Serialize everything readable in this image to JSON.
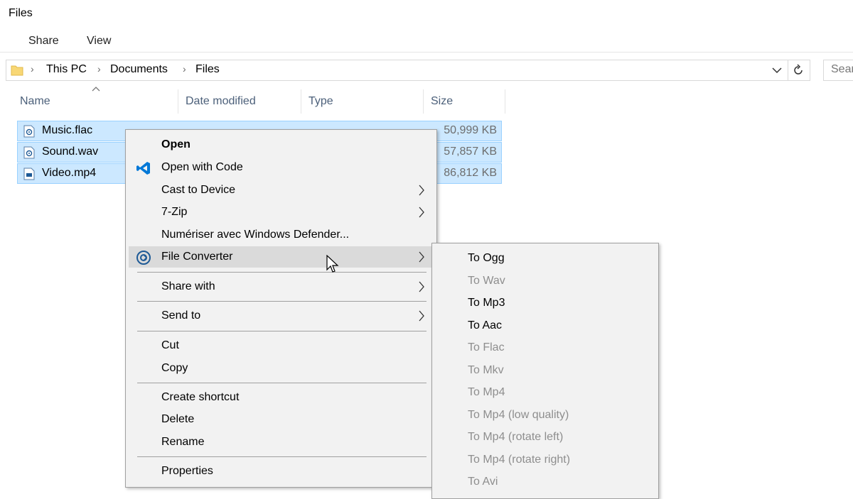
{
  "window": {
    "title": "Files"
  },
  "ribbon": {
    "tabs": [
      "Share",
      "View"
    ]
  },
  "address": {
    "crumbs": [
      "This PC",
      "Documents",
      "Files"
    ],
    "search_placeholder": "Search"
  },
  "columns": {
    "name": "Name",
    "date": "Date modified",
    "type": "Type",
    "size": "Size"
  },
  "files": [
    {
      "name": "Music.flac",
      "date": "",
      "type": "",
      "size": "50,999 KB",
      "icon": "audio-file-icon"
    },
    {
      "name": "Sound.wav",
      "date": "",
      "type": "",
      "size": "57,857 KB",
      "icon": "audio-file-icon"
    },
    {
      "name": "Video.mp4",
      "date": "",
      "type": "",
      "size": "86,812 KB",
      "icon": "video-file-icon"
    }
  ],
  "context_menu": {
    "items": {
      "open": "Open",
      "open_with_code": "Open with Code",
      "cast": "Cast to Device",
      "zip": "7-Zip",
      "defender": "Numériser avec Windows Defender...",
      "file_converter": "File Converter",
      "share_with": "Share with",
      "send_to": "Send to",
      "cut": "Cut",
      "copy": "Copy",
      "create_shortcut": "Create shortcut",
      "delete": "Delete",
      "rename": "Rename",
      "properties": "Properties"
    }
  },
  "submenu": {
    "items": [
      {
        "label": "To Ogg",
        "enabled": true
      },
      {
        "label": "To Wav",
        "enabled": false
      },
      {
        "label": "To Mp3",
        "enabled": true
      },
      {
        "label": "To Aac",
        "enabled": true
      },
      {
        "label": "To Flac",
        "enabled": false
      },
      {
        "label": "To Mkv",
        "enabled": false
      },
      {
        "label": "To Mp4",
        "enabled": false
      },
      {
        "label": "To Mp4 (low quality)",
        "enabled": false
      },
      {
        "label": "To Mp4 (rotate left)",
        "enabled": false
      },
      {
        "label": "To Mp4 (rotate right)",
        "enabled": false
      },
      {
        "label": "To Avi",
        "enabled": false
      }
    ]
  },
  "colors": {
    "selection_bg": "#cce8ff",
    "selection_border": "#99d1ff",
    "menu_bg": "#f2f2f2",
    "menu_highlight": "#dadada",
    "vscode_blue": "#0078d7",
    "header_text": "#4c607a",
    "disabled_text": "#8e8e8e"
  }
}
